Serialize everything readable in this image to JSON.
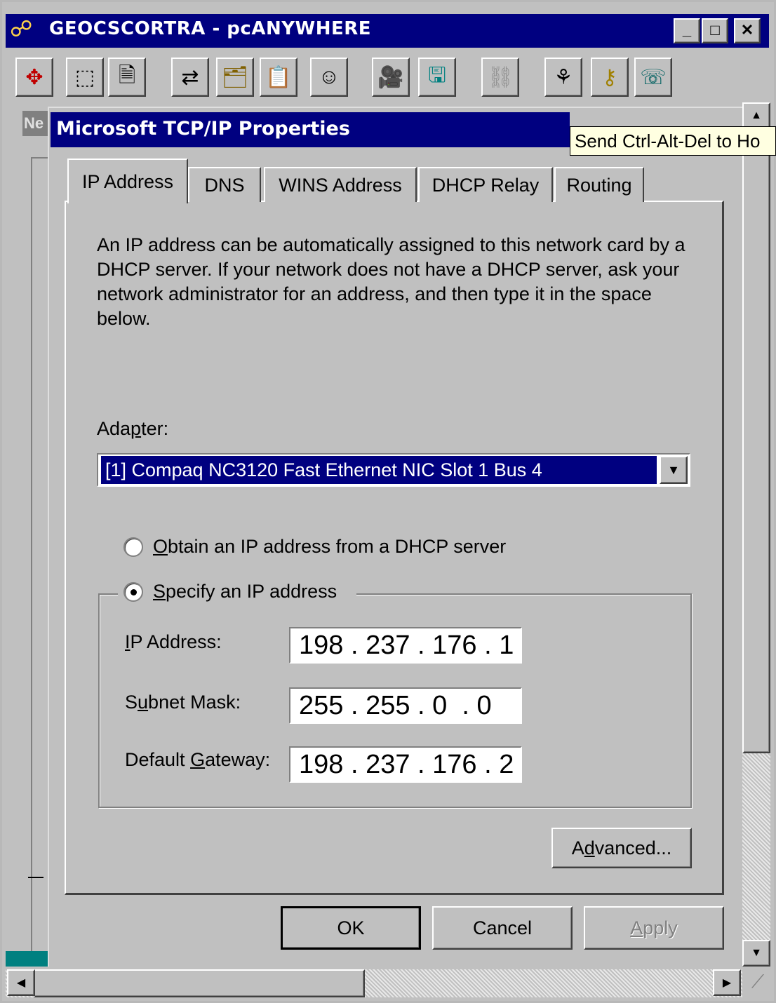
{
  "app": {
    "title": "GEOCSCORTRA - pcANYWHERE",
    "minimize_symbol": "_",
    "maximize_symbol": "□",
    "close_symbol": "✕",
    "left_panel_label": "Ne"
  },
  "toolbar": {
    "icons": [
      "arrows-icon",
      "select-area-icon",
      "properties-icon",
      "transfer-icon",
      "file-transfer-icon",
      "clipboard-icon",
      "chat-icon",
      "record-icon",
      "save-icon",
      "disconnected-icon",
      "send-ctrl-alt-del-icon",
      "key-icon",
      "help-icon"
    ]
  },
  "tooltip": {
    "text": "Send Ctrl-Alt-Del to Ho"
  },
  "dialog": {
    "title": "Microsoft TCP/IP Properties",
    "tabs": [
      {
        "label": "IP Address"
      },
      {
        "label": "DNS"
      },
      {
        "label": "WINS Address"
      },
      {
        "label": "DHCP Relay"
      },
      {
        "label": "Routing"
      }
    ],
    "info_text": "An IP address can be automatically assigned to this network card by a DHCP server.  If your network does not have a DHCP server, ask your network administrator for an address, and then type it in the space below.",
    "adapter": {
      "label_pre": "Ada",
      "label_accel": "p",
      "label_post": "ter:",
      "value": "[1] Compaq NC3120 Fast Ethernet NIC  Slot 1 Bus 4"
    },
    "radio_dhcp": {
      "accel": "O",
      "rest": "btain an IP address from a DHCP server"
    },
    "radio_specify": {
      "accel": "S",
      "rest": "pecify an IP address"
    },
    "fields": {
      "ip_label_accel": "I",
      "ip_label_rest": "P Address:",
      "ip_value": "198 . 237 . 176 . 1",
      "subnet_label_pre": "S",
      "subnet_label_accel": "u",
      "subnet_label_post": "bnet Mask:",
      "subnet_value": "255 . 255 . 0  . 0",
      "gateway_label_pre": "Default ",
      "gateway_label_accel": "G",
      "gateway_label_post": "ateway:",
      "gateway_value": "198 . 237 . 176 . 2"
    },
    "advanced_pre": "A",
    "advanced_accel": "d",
    "advanced_post": "vanced...",
    "ok_label": "OK",
    "cancel_label": "Cancel",
    "apply_accel": "A",
    "apply_rest": "pply"
  }
}
